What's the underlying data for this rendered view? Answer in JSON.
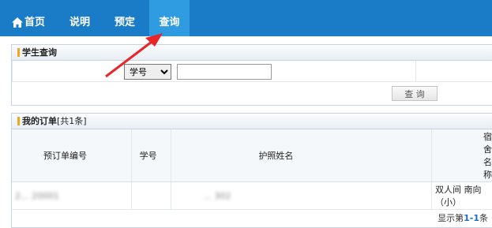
{
  "nav": {
    "home": "首页",
    "help": "说明",
    "book": "预定",
    "query": "查询"
  },
  "student_query": {
    "title": "学生查询",
    "select_value": "学号",
    "input_value": "",
    "button_label": "查 询"
  },
  "orders": {
    "title": "我的订单",
    "count_text": "[共1条]",
    "columns": [
      "预订单编号",
      "学号",
      "护照姓名",
      "宿舍名称"
    ],
    "rows": [
      {
        "order_id": "2... 20001",
        "student_id": "",
        "passport_name": "... 302",
        "dorm_name": "双人间 南向（小）"
      }
    ],
    "pager_prefix": "显示第",
    "pager_range": "1-1",
    "pager_suffix": "条"
  },
  "colors": {
    "nav_bg": "#1a7bc6",
    "nav_active": "#2f9be0",
    "accent_bar": "#f0a71a",
    "arrow": "#e8262a"
  },
  "icons": {
    "home": "home-icon",
    "dropdown": "chevron-down-icon"
  }
}
